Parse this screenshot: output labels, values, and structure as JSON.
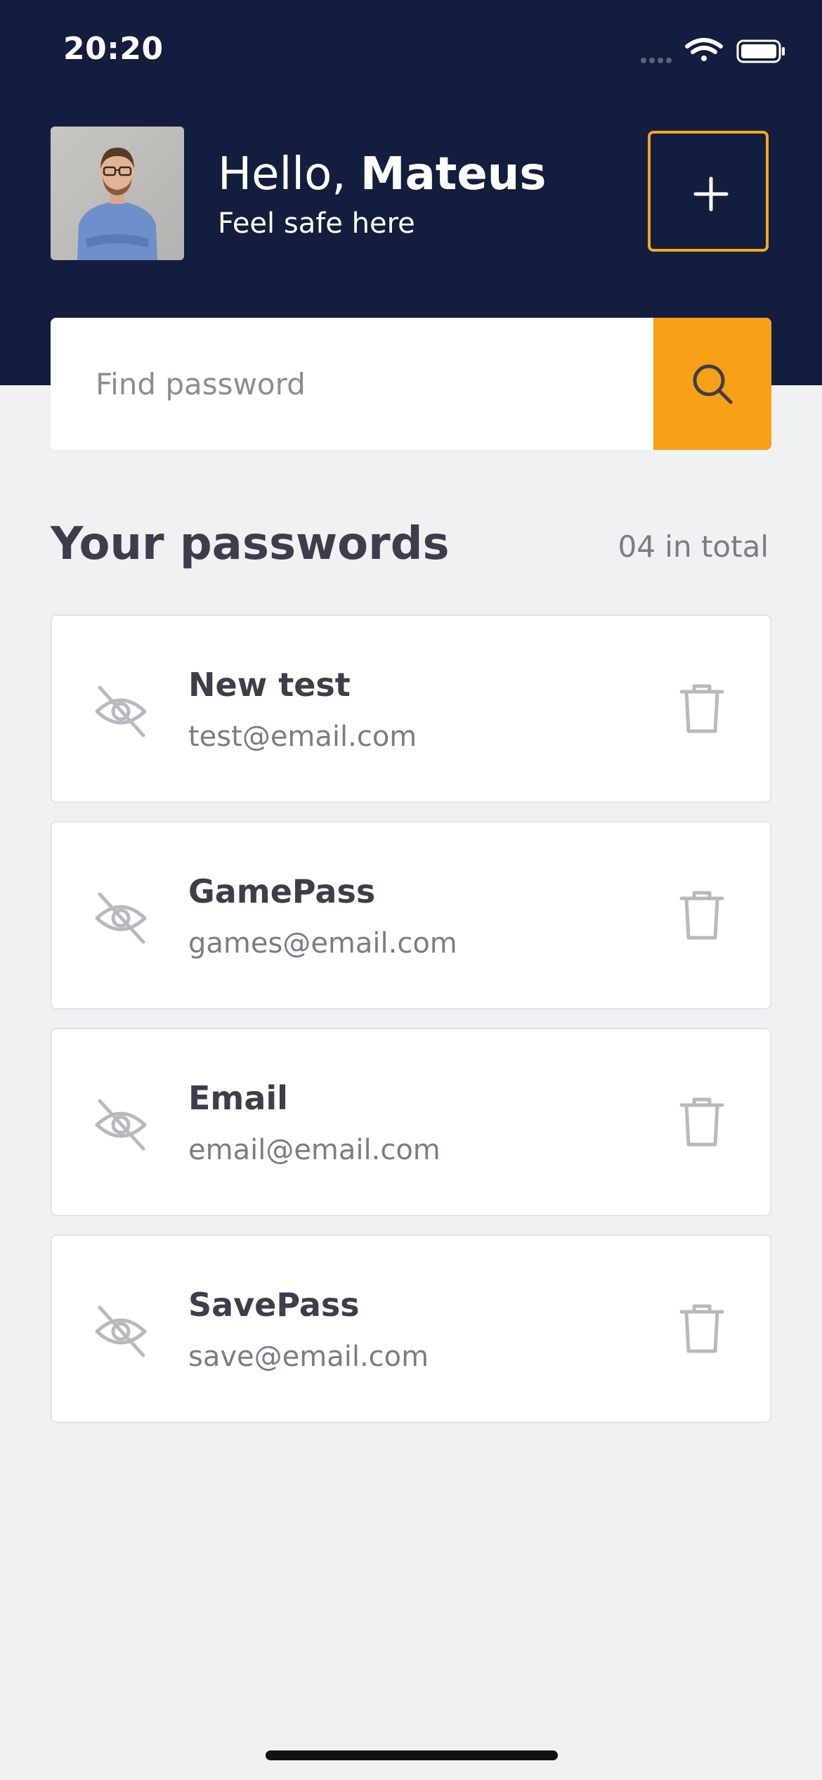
{
  "status_bar": {
    "time": "20:20",
    "icons": [
      "signal-dots-icon",
      "wifi-icon",
      "battery-icon"
    ]
  },
  "header": {
    "greeting_prefix": "Hello, ",
    "user_name": "Mateus",
    "subtitle": "Feel safe here",
    "add_button_icon": "plus-icon",
    "avatar": "user-avatar-photo"
  },
  "search": {
    "placeholder": "Find password",
    "button_icon": "search-icon"
  },
  "passwords_section": {
    "title": "Your passwords",
    "count_label": "04 in total",
    "items": [
      {
        "name": "New test",
        "email": "test@email.com"
      },
      {
        "name": "GamePass",
        "email": "games@email.com"
      },
      {
        "name": "Email",
        "email": "email@email.com"
      },
      {
        "name": "SavePass",
        "email": "save@email.com"
      }
    ]
  },
  "colors": {
    "header_bg": "#131D3E",
    "accent": "#F9A116",
    "page_bg": "#F0F1F3",
    "card_bg": "#FFFFFF",
    "text_dark": "#3D3D4C",
    "text_muted": "#7A7C86"
  }
}
